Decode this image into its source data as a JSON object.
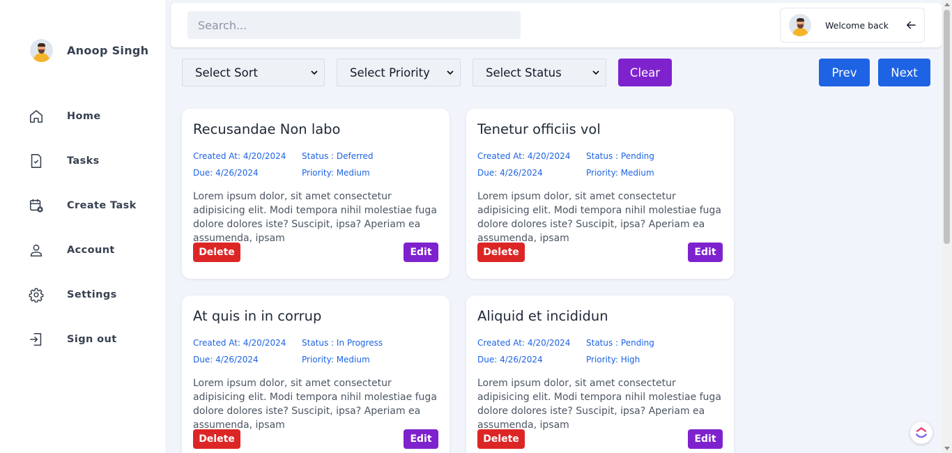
{
  "sidebar": {
    "profile_name": "Anoop Singh",
    "items": [
      {
        "label": "Home",
        "icon": "home-icon"
      },
      {
        "label": "Tasks",
        "icon": "task-file-icon"
      },
      {
        "label": "Create Task",
        "icon": "calendar-add-icon"
      },
      {
        "label": "Account",
        "icon": "user-icon"
      },
      {
        "label": "Settings",
        "icon": "gear-icon"
      },
      {
        "label": "Sign out",
        "icon": "sign-out-icon"
      }
    ]
  },
  "topbar": {
    "search_placeholder": "Search...",
    "welcome_text": "Welcome back"
  },
  "filters": {
    "sort": "Select Sort",
    "priority": "Select Priority",
    "status": "Select Status",
    "clear_label": "Clear",
    "prev_label": "Prev",
    "next_label": "Next"
  },
  "tasks": [
    {
      "title": "Recusandae Non labo",
      "created": "Created At: 4/20/2024",
      "status": "Status : Deferred",
      "due": "Due: 4/26/2024",
      "priority": "Priority: Medium",
      "description": "Lorem ipsum dolor, sit amet consectetur adipisicing elit. Modi tempora nihil molestiae fuga dolore dolores iste? Suscipit, ipsa? Aperiam ea assumenda, ipsam",
      "delete_label": "Delete",
      "edit_label": "Edit"
    },
    {
      "title": "Tenetur officiis vol",
      "created": "Created At: 4/20/2024",
      "status": "Status : Pending",
      "due": "Due: 4/26/2024",
      "priority": "Priority: Medium",
      "description": "Lorem ipsum dolor, sit amet consectetur adipisicing elit. Modi tempora nihil molestiae fuga dolore dolores iste? Suscipit, ipsa? Aperiam ea assumenda, ipsam",
      "delete_label": "Delete",
      "edit_label": "Edit"
    },
    {
      "title": "At quis in in corrup",
      "created": "Created At: 4/20/2024",
      "status": "Status : In Progress",
      "due": "Due: 4/26/2024",
      "priority": "Priority: Medium",
      "description": "Lorem ipsum dolor, sit amet consectetur adipisicing elit. Modi tempora nihil molestiae fuga dolore dolores iste? Suscipit, ipsa? Aperiam ea assumenda, ipsam",
      "delete_label": "Delete",
      "edit_label": "Edit"
    },
    {
      "title": "Aliquid et incididun",
      "created": "Created At: 4/20/2024",
      "status": "Status : Pending",
      "due": "Due: 4/26/2024",
      "priority": "Priority: High",
      "description": "Lorem ipsum dolor, sit amet consectetur adipisicing elit. Modi tempora nihil molestiae fuga dolore dolores iste? Suscipit, ipsa? Aperiam ea assumenda, ipsam",
      "delete_label": "Delete",
      "edit_label": "Edit"
    }
  ],
  "colors": {
    "accent_purple": "#7e22ce",
    "accent_blue": "#1d63e3",
    "danger_red": "#dc2626",
    "background": "#f1f5fb"
  }
}
